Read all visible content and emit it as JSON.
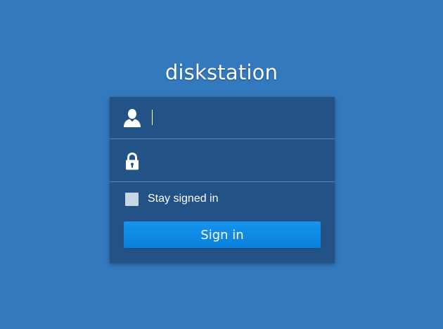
{
  "app": {
    "title": "diskstation"
  },
  "login_form": {
    "username": {
      "icon": "user-icon",
      "value": "",
      "placeholder": ""
    },
    "password": {
      "icon": "lock-icon",
      "value": "",
      "placeholder": ""
    },
    "remember": {
      "label": "Stay signed in",
      "checked": false
    },
    "submit_label": "Sign in"
  },
  "colors": {
    "background": "#3379be",
    "panel": "#235286",
    "button": "#0e8ae4",
    "checkbox": "#c9d6e4"
  }
}
